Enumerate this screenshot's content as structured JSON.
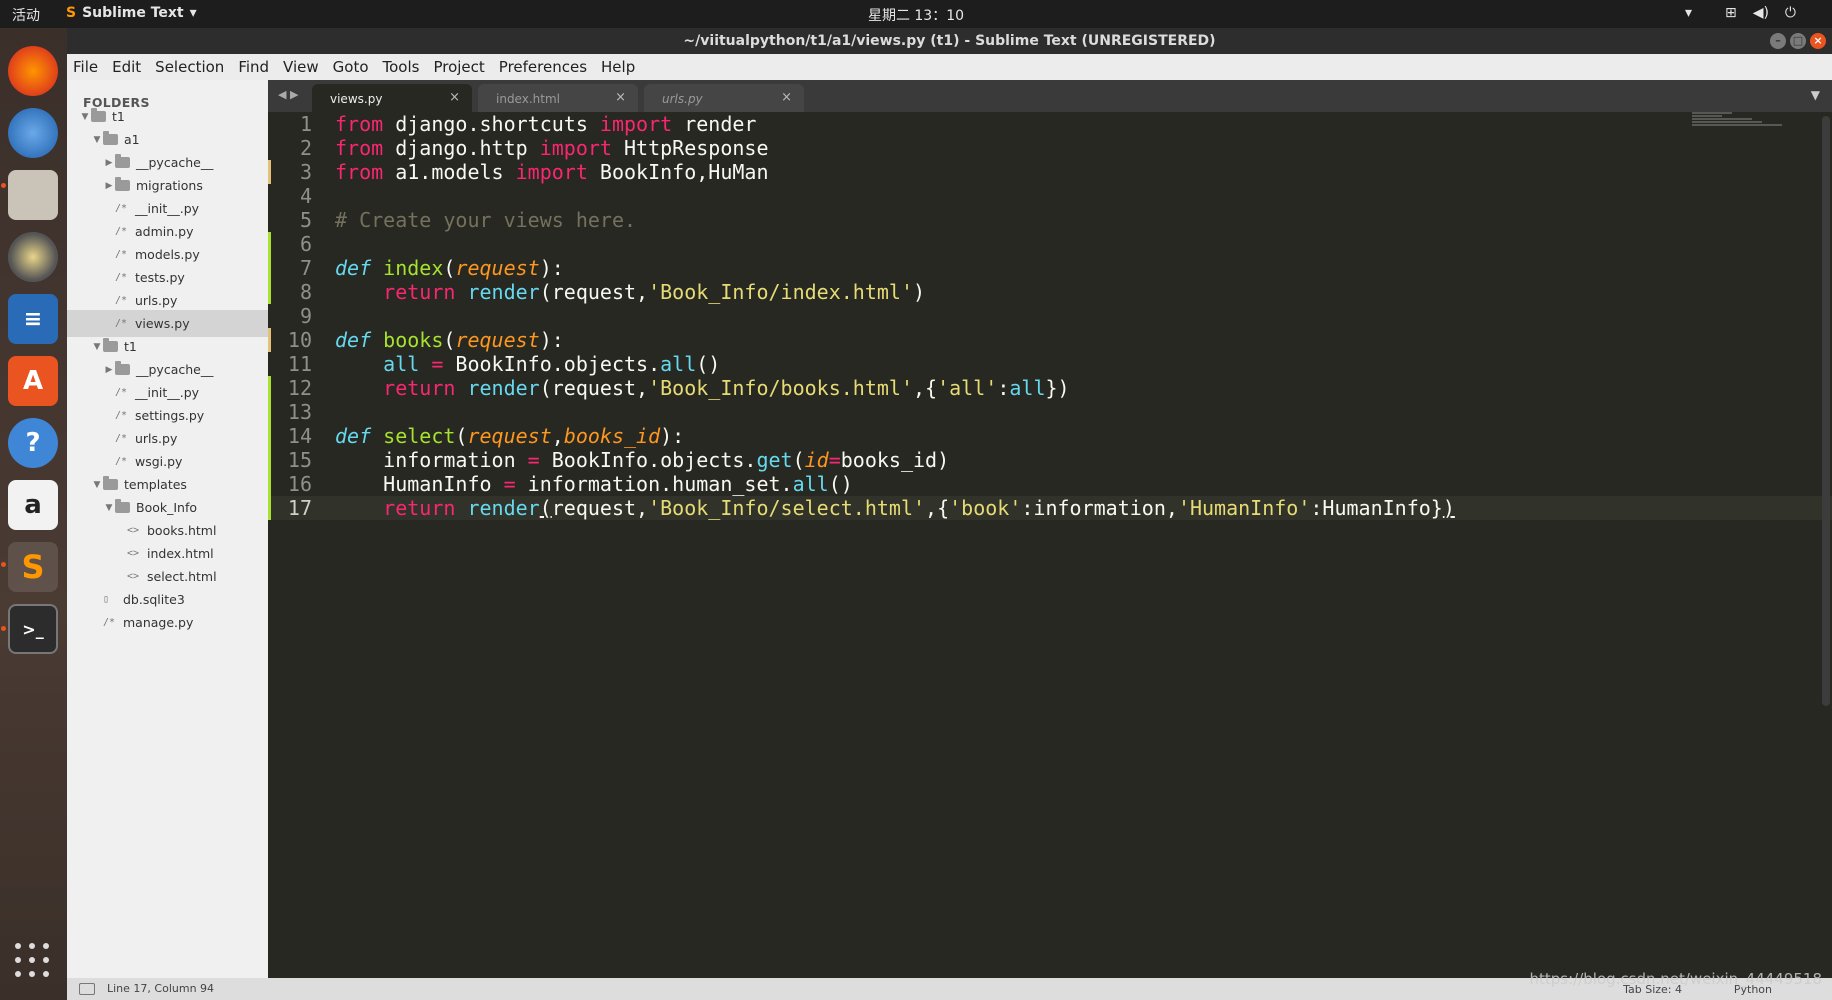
{
  "topbar": {
    "activities": "活动",
    "app_name": "Sublime Text",
    "clock": "星期二 13：10"
  },
  "window": {
    "title": "~/viitualpython/t1/a1/views.py (t1) - Sublime Text (UNREGISTERED)"
  },
  "menu": {
    "file": "File",
    "edit": "Edit",
    "selection": "Selection",
    "find": "Find",
    "view": "View",
    "goto": "Goto",
    "tools": "Tools",
    "project": "Project",
    "preferences": "Preferences",
    "help": "Help"
  },
  "sidebar": {
    "header": "FOLDERS",
    "items": [
      {
        "label": "t1"
      },
      {
        "label": "a1"
      },
      {
        "label": "__pycache__"
      },
      {
        "label": "migrations"
      },
      {
        "label": "__init__.py"
      },
      {
        "label": "admin.py"
      },
      {
        "label": "models.py"
      },
      {
        "label": "tests.py"
      },
      {
        "label": "urls.py"
      },
      {
        "label": "views.py"
      },
      {
        "label": "t1"
      },
      {
        "label": "__pycache__"
      },
      {
        "label": "__init__.py"
      },
      {
        "label": "settings.py"
      },
      {
        "label": "urls.py"
      },
      {
        "label": "wsgi.py"
      },
      {
        "label": "templates"
      },
      {
        "label": "Book_Info"
      },
      {
        "label": "books.html"
      },
      {
        "label": "index.html"
      },
      {
        "label": "select.html"
      },
      {
        "label": "db.sqlite3"
      },
      {
        "label": "manage.py"
      }
    ]
  },
  "tabs": [
    {
      "label": "views.py"
    },
    {
      "label": "index.html"
    },
    {
      "label": "urls.py"
    }
  ],
  "code": {
    "line_numbers": [
      "1",
      "2",
      "3",
      "4",
      "5",
      "6",
      "7",
      "8",
      "9",
      "10",
      "11",
      "12",
      "13",
      "14",
      "15",
      "16",
      "17"
    ],
    "comment": "# Create your views here."
  },
  "status": {
    "position": "Line 17, Column 94",
    "tab_size": "Tab Size: 4",
    "syntax": "Python"
  },
  "watermark": "https://blog.csdn.net/weixin_44449518",
  "colors": {
    "editor_bg": "#272822",
    "keyword": "#f92672",
    "function": "#a6e22e",
    "string": "#e6db74",
    "param": "#fd971f",
    "builtin": "#66d9ef",
    "accent": "#e95420"
  }
}
